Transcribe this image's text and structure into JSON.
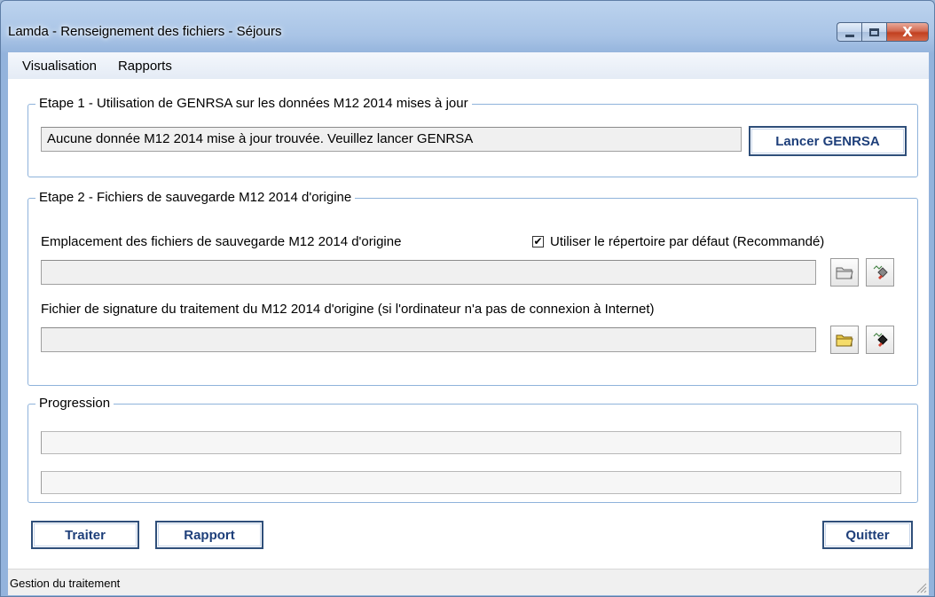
{
  "window": {
    "title": "Lamda - Renseignement des fichiers - Séjours",
    "close_glyph": "X"
  },
  "menu": {
    "items": [
      {
        "label": "Visualisation"
      },
      {
        "label": "Rapports"
      }
    ]
  },
  "step1": {
    "title": "Etape 1 - Utilisation de GENRSA sur les données M12 2014 mises à jour",
    "status": "Aucune donnée M12 2014 mise à jour trouvée. Veuillez lancer GENRSA",
    "launch_button": "Lancer GENRSA"
  },
  "step2": {
    "title": "Etape 2 - Fichiers de sauvegarde M12 2014 d'origine",
    "location_label": "Emplacement des fichiers de sauvegarde M12 2014 d'origine",
    "default_dir_checkbox": {
      "label": "Utiliser le répertoire par défaut (Recommandé)",
      "checked": true,
      "mark": "✔"
    },
    "location_value": "",
    "signature_label": "Fichier de signature du traitement du M12 2014 d'origine (si l'ordinateur n'a pas de connexion à Internet)",
    "signature_value": ""
  },
  "progress": {
    "title": "Progression",
    "bar1_value": 0,
    "bar2_value": 0
  },
  "actions": {
    "traiter": "Traiter",
    "rapport": "Rapport",
    "quitter": "Quitter"
  },
  "statusbar": {
    "text": "Gestion du traitement"
  },
  "colors": {
    "button_text": "#1e3f7a",
    "group_border": "#8fb3db",
    "close_button": "#c2401f"
  },
  "icons": [
    "minimize-icon",
    "maximize-icon",
    "close-icon",
    "folder-icon",
    "erase-icon",
    "resize-grip-icon"
  ]
}
